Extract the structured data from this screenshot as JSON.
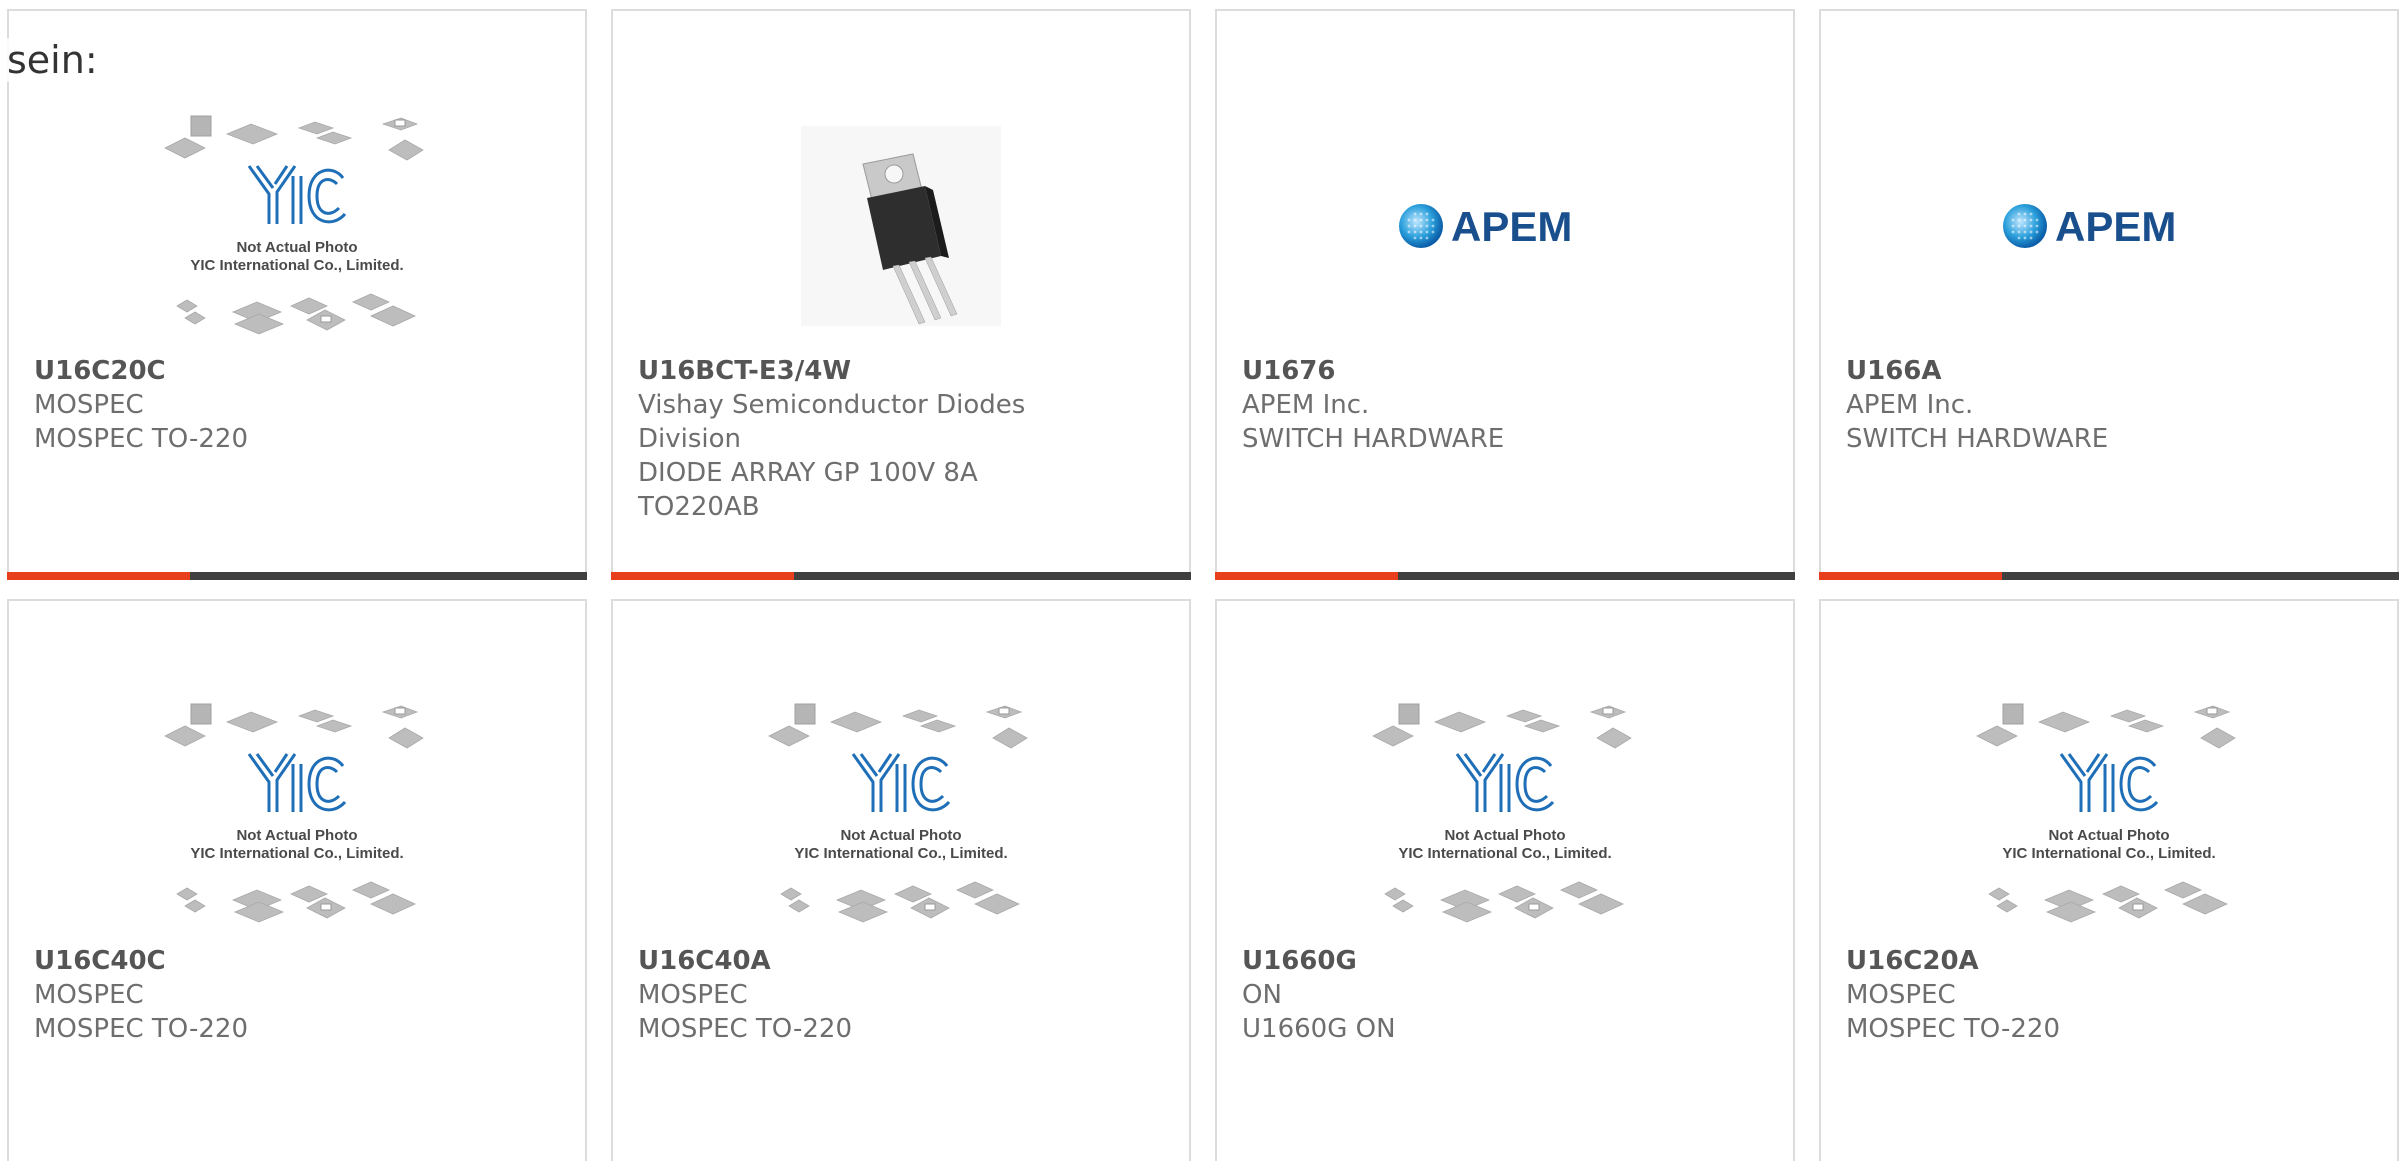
{
  "fragment_text": "sein:",
  "placeholder": {
    "line1": "Not Actual Photo",
    "line2": "YIC International Co., Limited."
  },
  "apem_logo_text": "APEM",
  "accent_color": "#e8401c",
  "bar_color": "#404040",
  "products": [
    {
      "part": "U16C20C",
      "maker": "MOSPEC",
      "desc": "MOSPEC TO-220",
      "image": "yic-placeholder"
    },
    {
      "part": "U16BCT-E3/4W",
      "maker": "Vishay Semiconductor Diodes",
      "maker2": "Division",
      "desc": "DIODE ARRAY GP 100V 8A",
      "desc2": "TO220AB",
      "image": "to220-photo"
    },
    {
      "part": "U1676",
      "maker": "APEM Inc.",
      "desc": "SWITCH HARDWARE",
      "image": "apem-logo"
    },
    {
      "part": "U166A",
      "maker": "APEM Inc.",
      "desc": "SWITCH HARDWARE",
      "image": "apem-logo"
    },
    {
      "part": "U16C40C",
      "maker": "MOSPEC",
      "desc": "MOSPEC TO-220",
      "image": "yic-placeholder"
    },
    {
      "part": "U16C40A",
      "maker": "MOSPEC",
      "desc": "MOSPEC TO-220",
      "image": "yic-placeholder"
    },
    {
      "part": "U1660G",
      "maker": "ON",
      "desc": "U1660G ON",
      "image": "yic-placeholder"
    },
    {
      "part": "U16C20A",
      "maker": "MOSPEC",
      "desc": "MOSPEC TO-220",
      "image": "yic-placeholder"
    }
  ]
}
